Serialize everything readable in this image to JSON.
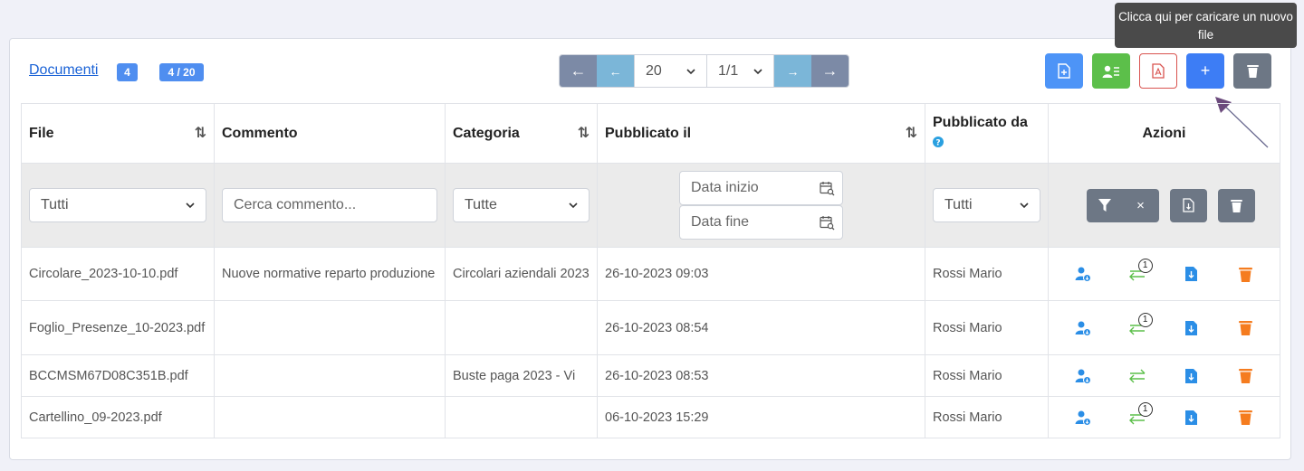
{
  "tooltip": {
    "text": "Clicca qui per caricare un nuovo file"
  },
  "header": {
    "title": "Documenti",
    "count_badge": "4",
    "range_badge": "4 / 20"
  },
  "pager": {
    "page_size": "20",
    "page": "1/1",
    "first": "←",
    "prev": "←",
    "next": "→",
    "last": "→"
  },
  "columns": {
    "file": "File",
    "commento": "Commento",
    "categoria": "Categoria",
    "pubblicato_il": "Pubblicato il",
    "pubblicato_da": "Pubblicato da",
    "azioni": "Azioni"
  },
  "filters": {
    "file": "Tutti",
    "commento_placeholder": "Cerca commento...",
    "categoria": "Tutte",
    "data_inizio": "Data inizio",
    "data_fine": "Data fine",
    "pubblicato_da": "Tutti",
    "clear": "×"
  },
  "rows": [
    {
      "file": "Circolare_2023-10-10.pdf",
      "commento": "Nuove normative reparto produzione",
      "categoria": "Circolari aziendali 2023",
      "data": "26-10-2023 09:03",
      "autore": "Rossi Mario",
      "share_count": "1"
    },
    {
      "file": "Foglio_Presenze_10-2023.pdf",
      "commento": "",
      "categoria": "",
      "data": "26-10-2023 08:54",
      "autore": "Rossi Mario",
      "share_count": "1"
    },
    {
      "file": "BCCMSM67D08C351B.pdf",
      "commento": "",
      "categoria": "Buste paga 2023 - Vi",
      "data": "26-10-2023 08:53",
      "autore": "Rossi Mario",
      "share_count": ""
    },
    {
      "file": "Cartellino_09-2023.pdf",
      "commento": "",
      "categoria": "",
      "data": "06-10-2023 15:29",
      "autore": "Rossi Mario",
      "share_count": "1"
    }
  ],
  "colors": {
    "primary": "#3d7df5",
    "success": "#5cbf4a",
    "danger": "#d9534f",
    "grey": "#6d7785",
    "orange": "#f57c1f"
  }
}
